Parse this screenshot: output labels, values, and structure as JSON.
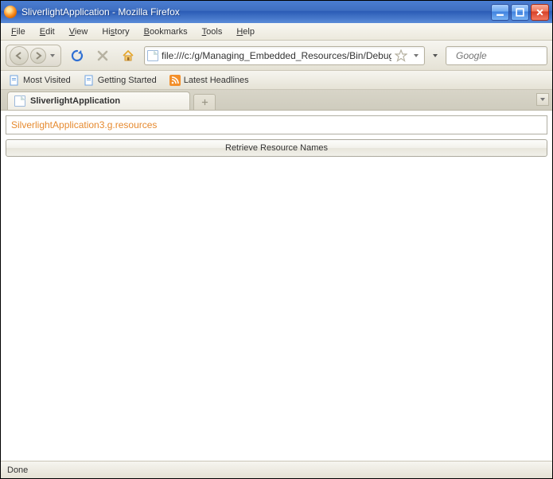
{
  "window": {
    "title": "SliverlightApplication - Mozilla Firefox"
  },
  "menu": {
    "file": "File",
    "edit": "Edit",
    "view": "View",
    "history": "History",
    "bookmarks": "Bookmarks",
    "tools": "Tools",
    "help": "Help"
  },
  "address": {
    "url": "file:///c:/g/Managing_Embedded_Resources/Bin/Debug/"
  },
  "search": {
    "placeholder": "Google"
  },
  "bookmarks_bar": {
    "most_visited": "Most Visited",
    "getting_started": "Getting Started",
    "latest_headlines": "Latest Headlines"
  },
  "tabs": {
    "active": "SliverlightApplication"
  },
  "page": {
    "resource_text": "SilverlightApplication3.g.resources",
    "button_label": "Retrieve Resource Names"
  },
  "status": {
    "text": "Done"
  }
}
